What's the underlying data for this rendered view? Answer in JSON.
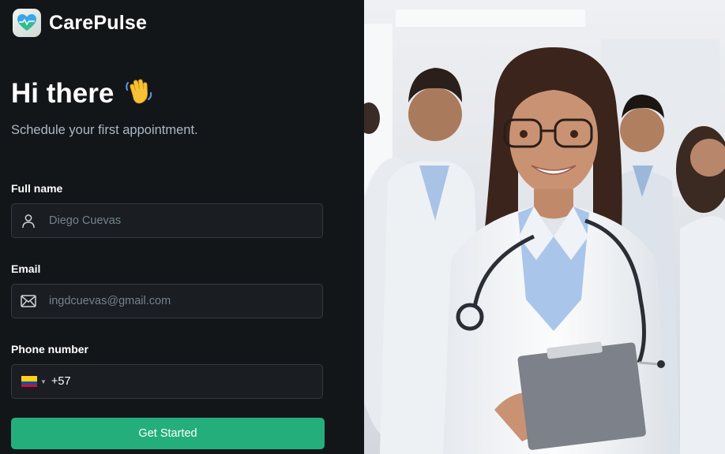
{
  "brand": {
    "name": "CarePulse",
    "logo_icon": "heart-pulse-icon",
    "accent": "#24ae7c"
  },
  "hero": {
    "title": "Hi there",
    "emoji": "👋",
    "subtitle": "Schedule your first appointment."
  },
  "form": {
    "full_name": {
      "label": "Full name",
      "placeholder": "Diego Cuevas",
      "icon": "user-icon"
    },
    "email": {
      "label": "Email",
      "placeholder": "ingdcuevas@gmail.com",
      "icon": "email-icon"
    },
    "phone": {
      "label": "Phone number",
      "country": "CO",
      "dial_code": "+57"
    },
    "submit_label": "Get Started"
  },
  "illustration": {
    "subject": "smiling female doctor holding clipboard with medical staff behind"
  }
}
